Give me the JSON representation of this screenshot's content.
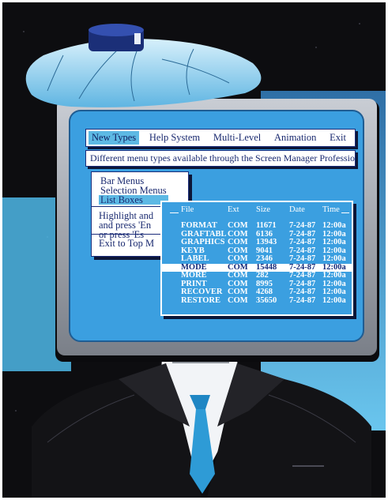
{
  "menu_bar": {
    "items": [
      {
        "label": "New Types",
        "active": true
      },
      {
        "label": "Help System",
        "active": false
      },
      {
        "label": "Multi-Level",
        "active": false
      },
      {
        "label": "Animation",
        "active": false
      },
      {
        "label": "Exit",
        "active": false
      }
    ]
  },
  "description": "Different menu types available through the Screen Manager Professional",
  "submenu": {
    "items": [
      {
        "label": "Bar Menus",
        "active": false
      },
      {
        "label": "Selection Menus",
        "active": false
      },
      {
        "label": "List Boxes",
        "active": true
      }
    ],
    "help_lines": [
      "Highlight and",
      "and press 'En",
      "or  press   'Es"
    ],
    "exit_label": "Exit to Top M"
  },
  "list_box": {
    "columns": [
      "File",
      "Ext",
      "Size",
      "Date",
      "Time"
    ],
    "selected_index": 5,
    "rows": [
      {
        "file": "FORMAT",
        "ext": "COM",
        "size": "11671",
        "date": "7-24-87",
        "time": "12:00a"
      },
      {
        "file": "GRAFTABL",
        "ext": "COM",
        "size": "6136",
        "date": "7-24-87",
        "time": "12:00a"
      },
      {
        "file": "GRAPHICS",
        "ext": "COM",
        "size": "13943",
        "date": "7-24-87",
        "time": "12:00a"
      },
      {
        "file": "KEYB",
        "ext": "COM",
        "size": "9041",
        "date": "7-24-87",
        "time": "12:00a"
      },
      {
        "file": "LABEL",
        "ext": "COM",
        "size": "2346",
        "date": "7-24-87",
        "time": "12:00a"
      },
      {
        "file": "MODE",
        "ext": "COM",
        "size": "15448",
        "date": "7-24-87",
        "time": "12:00a"
      },
      {
        "file": "MORE",
        "ext": "COM",
        "size": "282",
        "date": "7-24-87",
        "time": "12:00a"
      },
      {
        "file": "PRINT",
        "ext": "COM",
        "size": "8995",
        "date": "7-24-87",
        "time": "12:00a"
      },
      {
        "file": "RECOVER",
        "ext": "COM",
        "size": "4268",
        "date": "7-24-87",
        "time": "12:00a"
      },
      {
        "file": "RESTORE",
        "ext": "COM",
        "size": "35650",
        "date": "7-24-87",
        "time": "12:00a"
      }
    ]
  },
  "colors": {
    "screen_blue": "#3b9fe0",
    "highlight_cyan": "#5db9e4",
    "ice_pack_blue": "#7cc8ec",
    "suit_black": "#111111",
    "tie_blue": "#2e9bd6",
    "wall_blue": "#4fb8e8"
  },
  "icons": [
    "ice-pack",
    "monitor-head",
    "suit",
    "tie"
  ]
}
